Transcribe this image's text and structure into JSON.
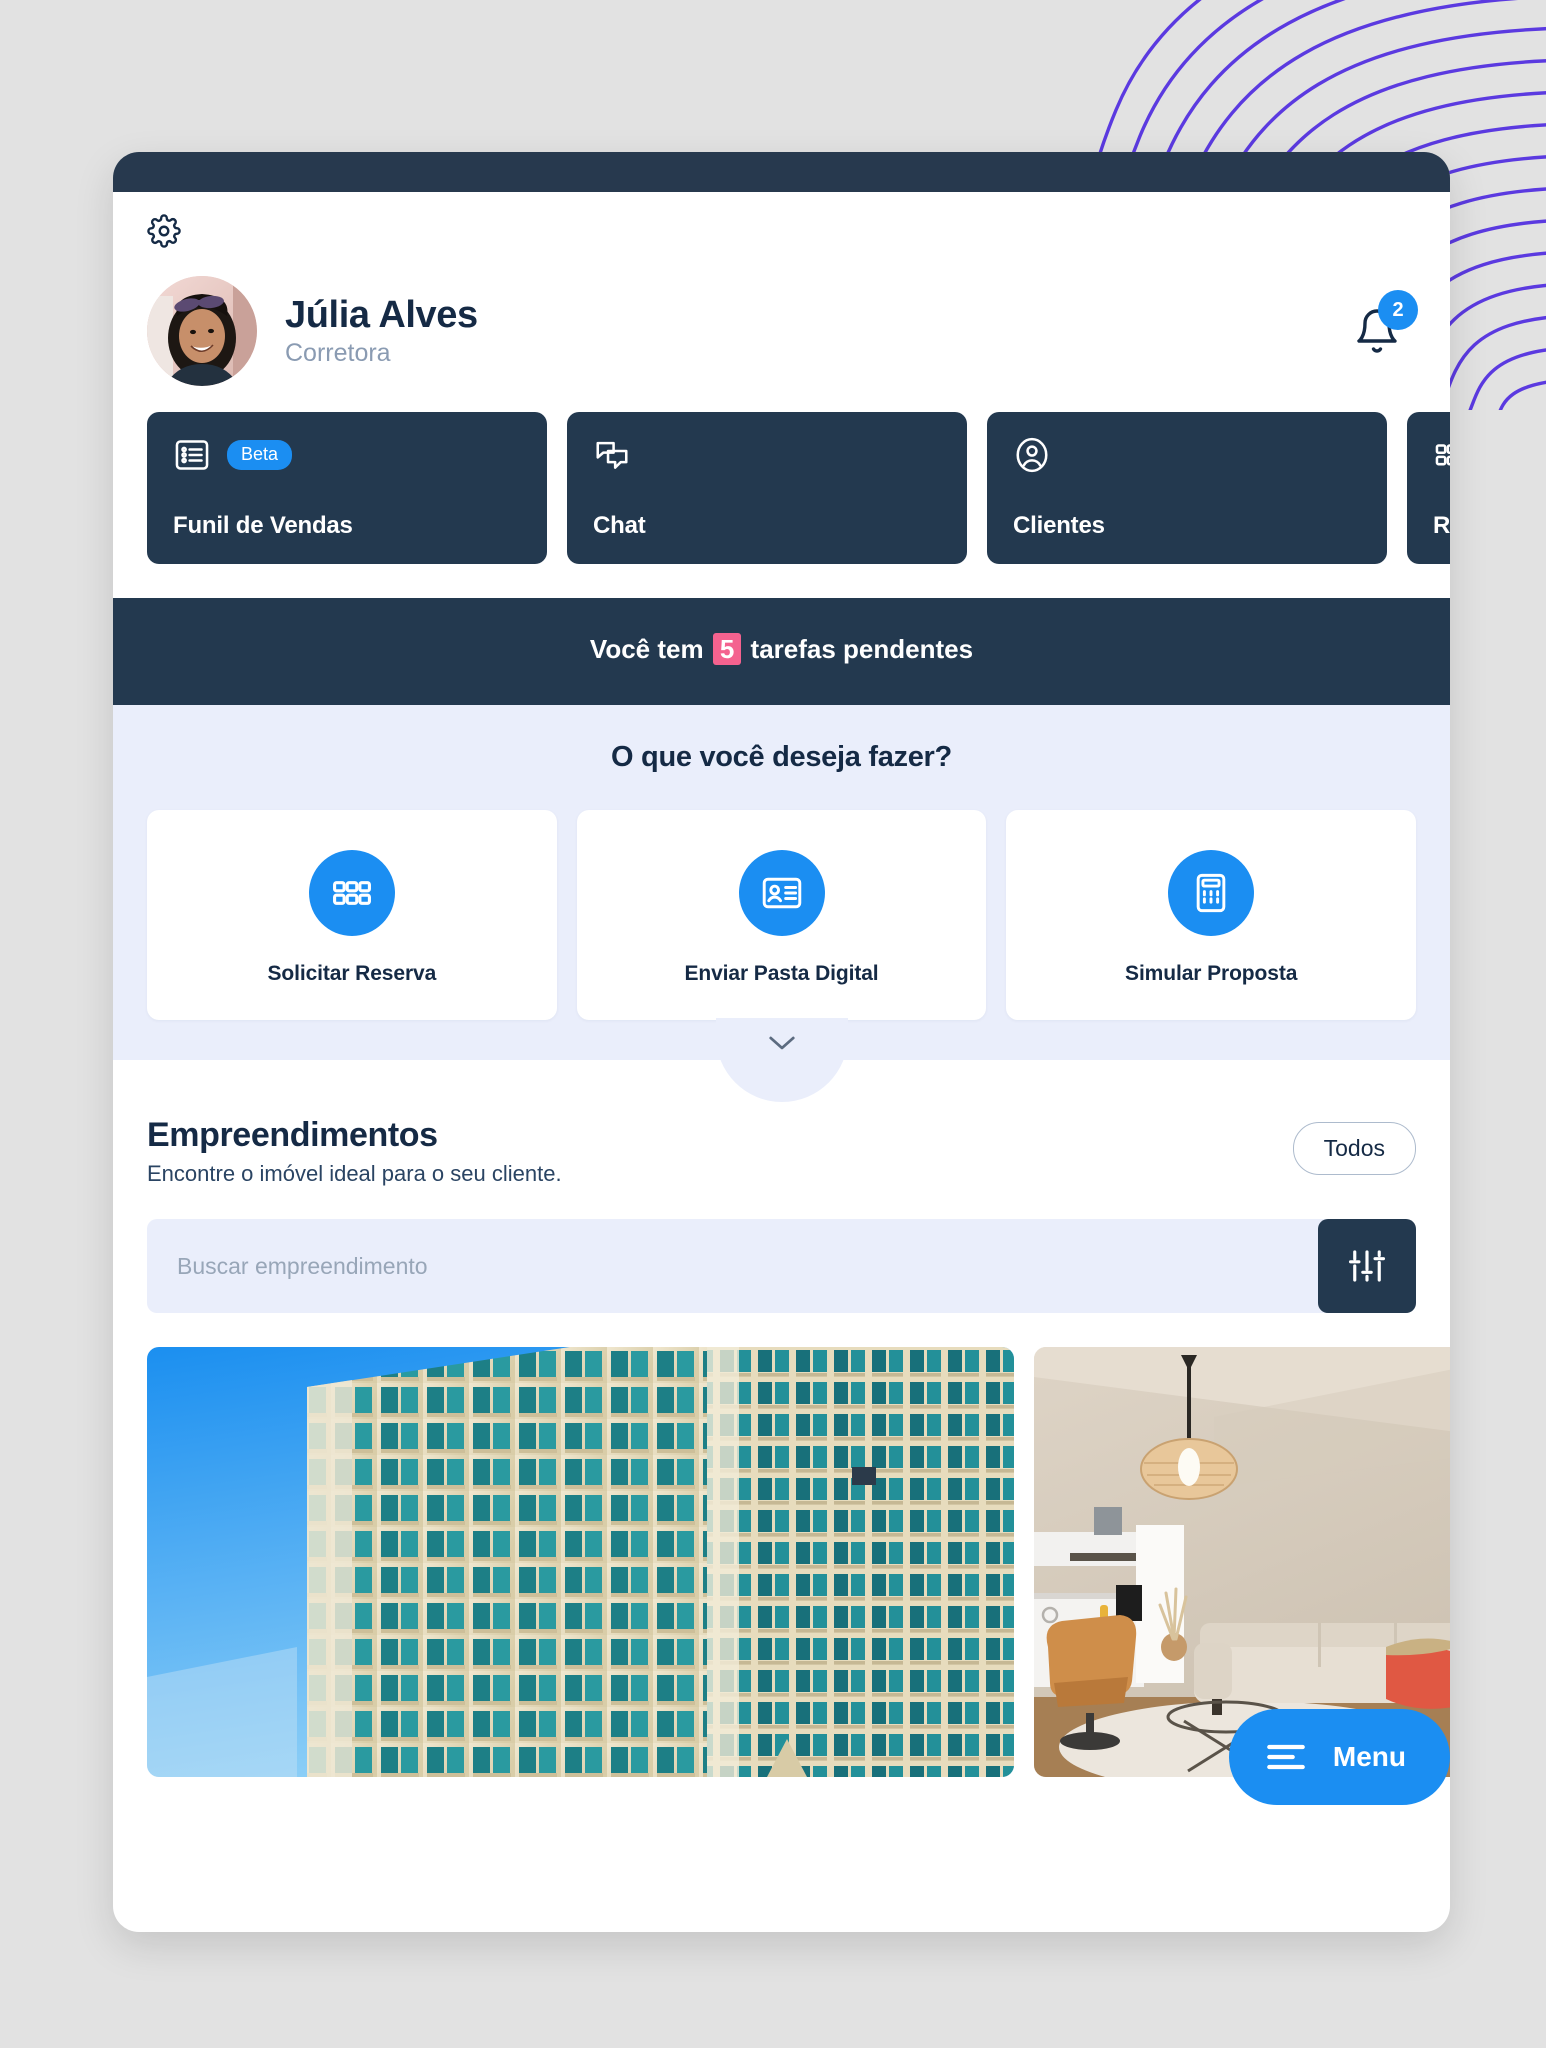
{
  "app": {
    "settings_icon": "gear-icon"
  },
  "profile": {
    "name": "Júlia Alves",
    "role": "Corretora",
    "avatar_alt": "Júlia Alves",
    "notifications": {
      "icon": "bell-icon",
      "count": "2"
    }
  },
  "nav_cards": [
    {
      "label": "Funil de Vendas",
      "icon": "list-icon",
      "badge": "Beta"
    },
    {
      "label": "Chat",
      "icon": "chat-bubbles-icon",
      "badge": ""
    },
    {
      "label": "Clientes",
      "icon": "user-circle-icon",
      "badge": ""
    },
    {
      "label": "Reservas",
      "icon": "grid-icon",
      "badge": ""
    }
  ],
  "tasks_banner": {
    "prefix": "Você  tem",
    "count": "5",
    "suffix": "tarefas pendentes"
  },
  "actions": {
    "title": "O que você deseja fazer?",
    "collapse_icon": "chevron-down-icon",
    "items": [
      {
        "label": "Solicitar Reserva",
        "icon": "grid-icon"
      },
      {
        "label": "Enviar Pasta Digital",
        "icon": "id-card-icon"
      },
      {
        "label": "Simular Proposta",
        "icon": "calculator-icon"
      }
    ]
  },
  "listing": {
    "title": "Empreendimentos",
    "subtitle": "Encontre o imóvel ideal para o seu cliente.",
    "filter_all_label": "Todos",
    "search_placeholder": "Buscar empreendimento",
    "search_value": "",
    "filter_icon": "sliders-icon",
    "properties": [
      {
        "alt": "Edifício residencial alto",
        "type": "building-exterior"
      },
      {
        "alt": "Sala de estar com cozinha integrada",
        "type": "living-room"
      }
    ]
  },
  "fab": {
    "label": "Menu",
    "icon": "hamburger-icon"
  },
  "colors": {
    "accent_blue": "#1b8ef2",
    "dark_navy": "#23394f",
    "text_navy": "#152a45",
    "panel_lavender": "#eaeefb",
    "highlight_pink": "#f4628f",
    "wave_purple": "#5b3ae0"
  }
}
